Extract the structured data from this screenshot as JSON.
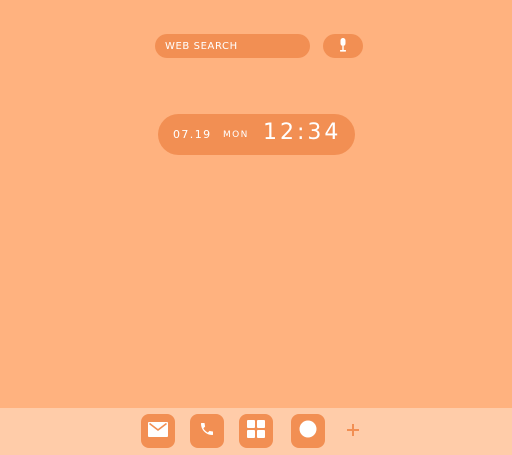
{
  "search": {
    "label": "WEB SEARCH"
  },
  "mic": {
    "icon": "microphone-icon"
  },
  "clock": {
    "date": "07.19",
    "day": "MON",
    "time": "12:34"
  },
  "dock": {
    "items": [
      {
        "icon": "mail-icon"
      },
      {
        "icon": "phone-icon"
      },
      {
        "icon": "apps-grid-icon"
      },
      {
        "icon": "circle-icon"
      }
    ],
    "add_icon": "plus-icon"
  },
  "colors": {
    "background": "#FFB27F",
    "accent": "#F28F53",
    "dock_background": "#FFCCA9",
    "foreground": "#FFFFFF"
  }
}
